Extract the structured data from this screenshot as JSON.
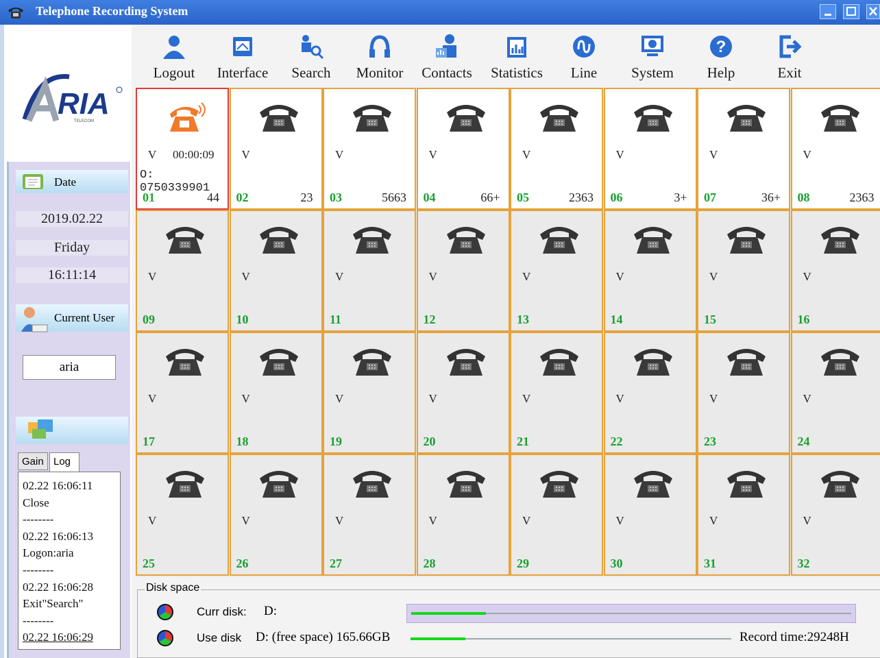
{
  "window": {
    "title": "Telephone Recording System"
  },
  "sidebar": {
    "date_label": "Date",
    "date": "2019.02.22",
    "weekday": "Friday",
    "time": "16:11:14",
    "user_label": "Current User",
    "user": "aria",
    "tabs": [
      "Gain",
      "Log"
    ],
    "log_lines": [
      "02.22 16:06:11",
      "Close",
      "--------",
      "02.22 16:06:13",
      "Logon:aria",
      "--------",
      "02.22 16:06:28",
      "Exit\"Search\"",
      "--------",
      "02.22 16:06:29"
    ]
  },
  "toolbar": [
    {
      "label": "Logout",
      "icon": "user-icon"
    },
    {
      "label": "Interface",
      "icon": "interface-icon"
    },
    {
      "label": "Search",
      "icon": "search-icon"
    },
    {
      "label": "Monitor",
      "icon": "headphones-icon"
    },
    {
      "label": "Contacts",
      "icon": "contacts-icon"
    },
    {
      "label": "Statistics",
      "icon": "statistics-icon"
    },
    {
      "label": "Line",
      "icon": "line-icon"
    },
    {
      "label": "System",
      "icon": "system-icon"
    },
    {
      "label": "Help",
      "icon": "help-icon"
    },
    {
      "label": "Exit",
      "icon": "exit-icon"
    }
  ],
  "channels": [
    {
      "id": "01",
      "mark": "V",
      "duration": "00:00:09",
      "number": "O: 0750339901",
      "count": "44",
      "active": true
    },
    {
      "id": "02",
      "mark": "V",
      "count": "23"
    },
    {
      "id": "03",
      "mark": "V",
      "count": "5663"
    },
    {
      "id": "04",
      "mark": "V",
      "count": "66+"
    },
    {
      "id": "05",
      "mark": "V",
      "count": "2363"
    },
    {
      "id": "06",
      "mark": "V",
      "count": "3+"
    },
    {
      "id": "07",
      "mark": "V",
      "count": "36+"
    },
    {
      "id": "08",
      "mark": "V",
      "count": "2363"
    },
    {
      "id": "09",
      "mark": "V",
      "count": ""
    },
    {
      "id": "10",
      "mark": "V",
      "count": ""
    },
    {
      "id": "11",
      "mark": "V",
      "count": ""
    },
    {
      "id": "12",
      "mark": "V",
      "count": ""
    },
    {
      "id": "13",
      "mark": "V",
      "count": ""
    },
    {
      "id": "14",
      "mark": "V",
      "count": ""
    },
    {
      "id": "15",
      "mark": "V",
      "count": ""
    },
    {
      "id": "16",
      "mark": "V",
      "count": ""
    },
    {
      "id": "17",
      "mark": "V",
      "count": ""
    },
    {
      "id": "18",
      "mark": "V",
      "count": ""
    },
    {
      "id": "19",
      "mark": "V",
      "count": ""
    },
    {
      "id": "20",
      "mark": "V",
      "count": ""
    },
    {
      "id": "21",
      "mark": "V",
      "count": ""
    },
    {
      "id": "22",
      "mark": "V",
      "count": ""
    },
    {
      "id": "23",
      "mark": "V",
      "count": ""
    },
    {
      "id": "24",
      "mark": "V",
      "count": ""
    },
    {
      "id": "25",
      "mark": "V",
      "count": ""
    },
    {
      "id": "26",
      "mark": "V",
      "count": ""
    },
    {
      "id": "27",
      "mark": "V",
      "count": ""
    },
    {
      "id": "28",
      "mark": "V",
      "count": ""
    },
    {
      "id": "29",
      "mark": "V",
      "count": ""
    },
    {
      "id": "30",
      "mark": "V",
      "count": ""
    },
    {
      "id": "31",
      "mark": "V",
      "count": ""
    },
    {
      "id": "32",
      "mark": "V",
      "count": ""
    }
  ],
  "disk": {
    "legend": "Disk space",
    "curr_label": "Curr disk:",
    "curr_value": "D:",
    "use_label": "Use disk",
    "use_value": "D: (free space)  165.66GB",
    "record_time": "Record time:29248H",
    "curr_fill_fraction": 0.17,
    "use_fill_fraction": 0.17
  },
  "colors": {
    "title_bar": "#2a63c8",
    "cell_border": "#e5a33b",
    "active_border": "#e23a3a",
    "channel_id": "#18a030",
    "active_phone": "#f07a2a"
  }
}
